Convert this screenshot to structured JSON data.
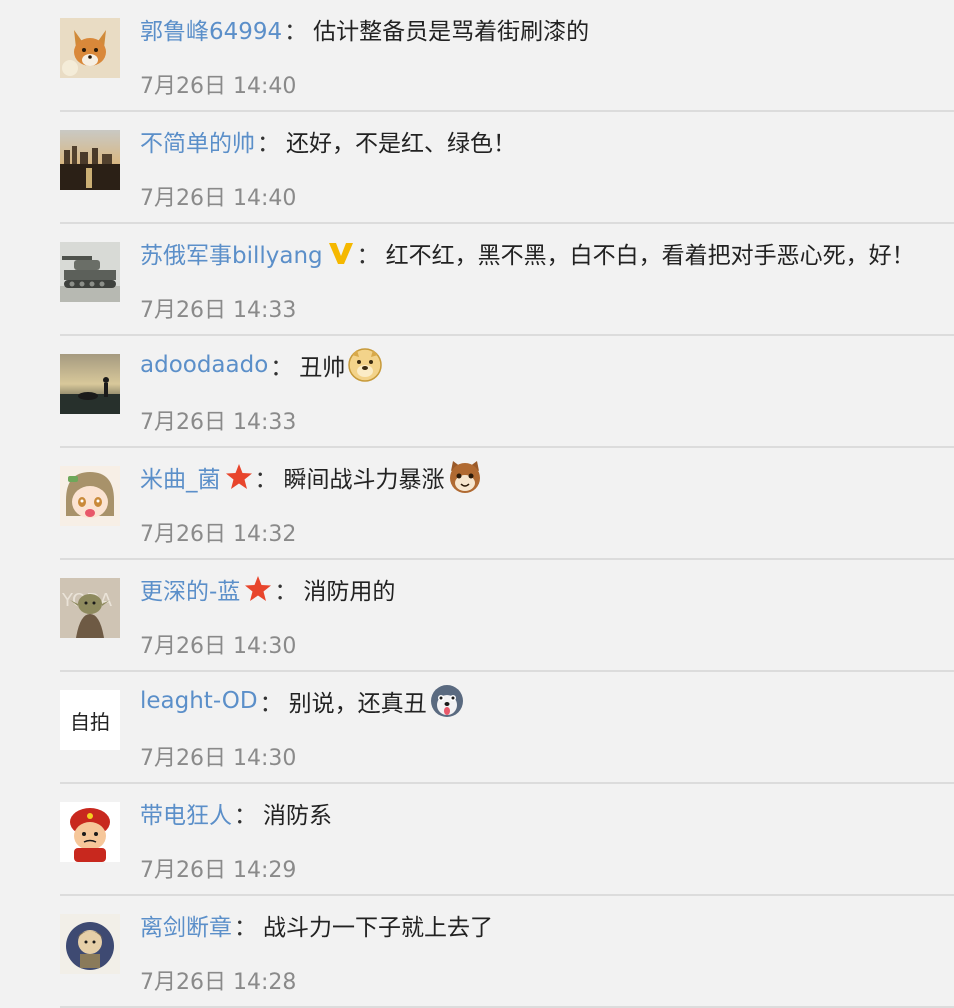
{
  "comments": [
    {
      "user": "郭鲁峰64994",
      "text": "估计整备员是骂着街刷漆的",
      "time": "7月26日 14:40",
      "avatar": "fox-avatar",
      "badge": null,
      "emoji": null
    },
    {
      "user": "不简单的帅",
      "text": "还好，不是红、绿色！",
      "time": "7月26日 14:40",
      "avatar": "city-sunset-avatar",
      "badge": null,
      "emoji": null
    },
    {
      "user": "苏俄军事billyang",
      "text": "红不红，黑不黑，白不白，看着把对手恶心死，好！",
      "time": "7月26日 14:33",
      "avatar": "tank-avatar",
      "badge": "verified-v-icon",
      "emoji": null
    },
    {
      "user": "adoodaado",
      "text": "丑帅",
      "time": "7月26日 14:33",
      "avatar": "silhouette-sunset-avatar",
      "badge": null,
      "emoji": "doge-emoji"
    },
    {
      "user": "米曲_菌",
      "text": "瞬间战斗力暴涨",
      "time": "7月26日 14:32",
      "avatar": "anime-girl-avatar",
      "badge": "star-badge-icon",
      "emoji": "cat-emoji"
    },
    {
      "user": "更深的-蓝",
      "text": "消防用的",
      "time": "7月26日 14:30",
      "avatar": "yoda-avatar",
      "badge": "star-badge-icon",
      "emoji": null
    },
    {
      "user": "leaght-OD",
      "text": "别说，还真丑",
      "time": "7月26日 14:30",
      "avatar": "text-avatar",
      "avatar_text": "自拍",
      "badge": null,
      "emoji": "husky-emoji"
    },
    {
      "user": "带电狂人",
      "text": "消防系",
      "time": "7月26日 14:29",
      "avatar": "cartoon-soldier-avatar",
      "badge": null,
      "emoji": null
    },
    {
      "user": "离剑断章",
      "text": "战斗力一下子就上去了",
      "time": "7月26日 14:28",
      "avatar": "knight-avatar",
      "badge": null,
      "emoji": null
    }
  ],
  "colors": {
    "username": "#5b8fc9",
    "comment_text": "#222222",
    "timestamp": "#8a8a8a",
    "background": "#f2f2f2",
    "divider": "#dcdcdc"
  }
}
